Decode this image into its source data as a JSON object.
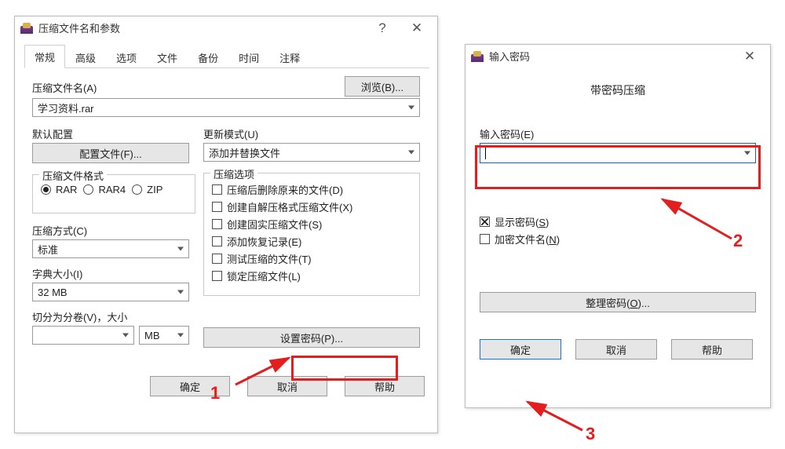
{
  "main": {
    "title": "压缩文件名和参数",
    "help_glyph": "?",
    "close_glyph": "✕",
    "tabs": [
      "常规",
      "高级",
      "选项",
      "文件",
      "备份",
      "时间",
      "注释"
    ],
    "active_tab_index": 0,
    "archive_name_label": "压缩文件名(A)",
    "archive_name_value": "学习资料.rar",
    "browse_btn": "浏览(B)...",
    "default_profile_label": "默认配置",
    "profile_btn": "配置文件(F)...",
    "update_mode_label": "更新模式(U)",
    "update_mode_value": "添加并替换文件",
    "format_group_title": "压缩文件格式",
    "format_options": [
      "RAR",
      "RAR4",
      "ZIP"
    ],
    "format_selected_index": 0,
    "options_group_title": "压缩选项",
    "option_items": [
      "压缩后删除原来的文件(D)",
      "创建自解压格式压缩文件(X)",
      "创建固实压缩文件(S)",
      "添加恢复记录(E)",
      "测试压缩的文件(T)",
      "锁定压缩文件(L)"
    ],
    "method_label": "压缩方式(C)",
    "method_value": "标准",
    "dict_label": "字典大小(I)",
    "dict_value": "32 MB",
    "split_label": "切分为分卷(V)，大小",
    "split_value": "",
    "split_unit": "MB",
    "set_password_btn": "设置密码(P)...",
    "ok_btn": "确定",
    "cancel_btn": "取消",
    "help_btn": "帮助"
  },
  "pw": {
    "title": "输入密码",
    "close_glyph": "✕",
    "section_title": "带密码压缩",
    "pw_label": "输入密码(E)",
    "pw_value": "",
    "show_pw_label_pre": "显示密码(",
    "show_pw_key": "S",
    "show_pw_label_post": ")",
    "show_pw_checked": true,
    "encrypt_names_pre": "加密文件名(",
    "encrypt_names_key": "N",
    "encrypt_names_post": ")",
    "encrypt_names_checked": false,
    "organize_btn_pre": "整理密码(",
    "organize_btn_key": "O",
    "organize_btn_post": ")...",
    "ok_btn": "确定",
    "cancel_btn": "取消",
    "help_btn": "帮助"
  },
  "annotations": {
    "num1": "1",
    "num2": "2",
    "num3": "3"
  }
}
